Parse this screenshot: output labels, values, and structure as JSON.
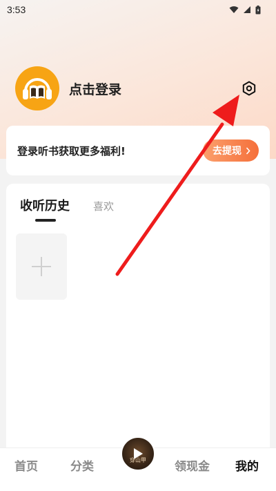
{
  "status_bar": {
    "time": "3:53",
    "icons": [
      "wifi-icon",
      "signal-icon",
      "battery-icon"
    ]
  },
  "profile": {
    "login_label": "点击登录",
    "avatar_icon": "headphones-book-icon",
    "settings_icon": "gear-icon"
  },
  "promo": {
    "text": "登录听书获取更多福利!",
    "button_label": "去提现"
  },
  "history": {
    "tabs": [
      {
        "label": "收听历史",
        "active": true
      },
      {
        "label": "喜欢",
        "active": false
      }
    ],
    "add_tile_icon": "plus-icon"
  },
  "bottom_nav": {
    "items": [
      {
        "label": "首页",
        "active": false
      },
      {
        "label": "分类",
        "active": false
      },
      {
        "label": "领现金",
        "active": false
      },
      {
        "label": "我的",
        "active": true
      }
    ],
    "center_disc_text": "穿山甲"
  },
  "colors": {
    "accent_orange": "#f56f3a",
    "avatar_yellow": "#f7a414",
    "annotation_red": "#ee1c1c"
  }
}
